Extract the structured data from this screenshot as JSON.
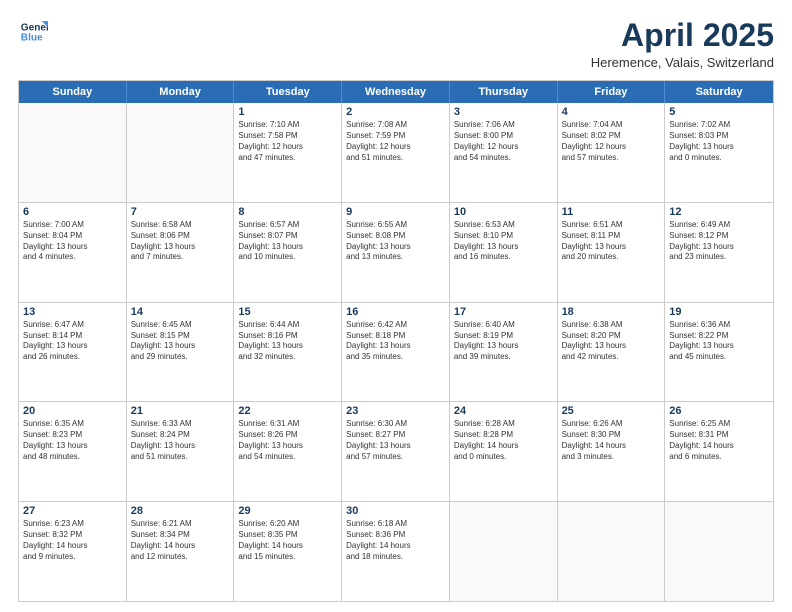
{
  "header": {
    "logo_line1": "General",
    "logo_line2": "Blue",
    "month": "April 2025",
    "location": "Heremence, Valais, Switzerland"
  },
  "days_of_week": [
    "Sunday",
    "Monday",
    "Tuesday",
    "Wednesday",
    "Thursday",
    "Friday",
    "Saturday"
  ],
  "weeks": [
    [
      {
        "day": "",
        "empty": true
      },
      {
        "day": "",
        "empty": true
      },
      {
        "day": "1",
        "lines": [
          "Sunrise: 7:10 AM",
          "Sunset: 7:58 PM",
          "Daylight: 12 hours",
          "and 47 minutes."
        ]
      },
      {
        "day": "2",
        "lines": [
          "Sunrise: 7:08 AM",
          "Sunset: 7:59 PM",
          "Daylight: 12 hours",
          "and 51 minutes."
        ]
      },
      {
        "day": "3",
        "lines": [
          "Sunrise: 7:06 AM",
          "Sunset: 8:00 PM",
          "Daylight: 12 hours",
          "and 54 minutes."
        ]
      },
      {
        "day": "4",
        "lines": [
          "Sunrise: 7:04 AM",
          "Sunset: 8:02 PM",
          "Daylight: 12 hours",
          "and 57 minutes."
        ]
      },
      {
        "day": "5",
        "lines": [
          "Sunrise: 7:02 AM",
          "Sunset: 8:03 PM",
          "Daylight: 13 hours",
          "and 0 minutes."
        ]
      }
    ],
    [
      {
        "day": "6",
        "lines": [
          "Sunrise: 7:00 AM",
          "Sunset: 8:04 PM",
          "Daylight: 13 hours",
          "and 4 minutes."
        ]
      },
      {
        "day": "7",
        "lines": [
          "Sunrise: 6:58 AM",
          "Sunset: 8:06 PM",
          "Daylight: 13 hours",
          "and 7 minutes."
        ]
      },
      {
        "day": "8",
        "lines": [
          "Sunrise: 6:57 AM",
          "Sunset: 8:07 PM",
          "Daylight: 13 hours",
          "and 10 minutes."
        ]
      },
      {
        "day": "9",
        "lines": [
          "Sunrise: 6:55 AM",
          "Sunset: 8:08 PM",
          "Daylight: 13 hours",
          "and 13 minutes."
        ]
      },
      {
        "day": "10",
        "lines": [
          "Sunrise: 6:53 AM",
          "Sunset: 8:10 PM",
          "Daylight: 13 hours",
          "and 16 minutes."
        ]
      },
      {
        "day": "11",
        "lines": [
          "Sunrise: 6:51 AM",
          "Sunset: 8:11 PM",
          "Daylight: 13 hours",
          "and 20 minutes."
        ]
      },
      {
        "day": "12",
        "lines": [
          "Sunrise: 6:49 AM",
          "Sunset: 8:12 PM",
          "Daylight: 13 hours",
          "and 23 minutes."
        ]
      }
    ],
    [
      {
        "day": "13",
        "lines": [
          "Sunrise: 6:47 AM",
          "Sunset: 8:14 PM",
          "Daylight: 13 hours",
          "and 26 minutes."
        ]
      },
      {
        "day": "14",
        "lines": [
          "Sunrise: 6:45 AM",
          "Sunset: 8:15 PM",
          "Daylight: 13 hours",
          "and 29 minutes."
        ]
      },
      {
        "day": "15",
        "lines": [
          "Sunrise: 6:44 AM",
          "Sunset: 8:16 PM",
          "Daylight: 13 hours",
          "and 32 minutes."
        ]
      },
      {
        "day": "16",
        "lines": [
          "Sunrise: 6:42 AM",
          "Sunset: 8:18 PM",
          "Daylight: 13 hours",
          "and 35 minutes."
        ]
      },
      {
        "day": "17",
        "lines": [
          "Sunrise: 6:40 AM",
          "Sunset: 8:19 PM",
          "Daylight: 13 hours",
          "and 39 minutes."
        ]
      },
      {
        "day": "18",
        "lines": [
          "Sunrise: 6:38 AM",
          "Sunset: 8:20 PM",
          "Daylight: 13 hours",
          "and 42 minutes."
        ]
      },
      {
        "day": "19",
        "lines": [
          "Sunrise: 6:36 AM",
          "Sunset: 8:22 PM",
          "Daylight: 13 hours",
          "and 45 minutes."
        ]
      }
    ],
    [
      {
        "day": "20",
        "lines": [
          "Sunrise: 6:35 AM",
          "Sunset: 8:23 PM",
          "Daylight: 13 hours",
          "and 48 minutes."
        ]
      },
      {
        "day": "21",
        "lines": [
          "Sunrise: 6:33 AM",
          "Sunset: 8:24 PM",
          "Daylight: 13 hours",
          "and 51 minutes."
        ]
      },
      {
        "day": "22",
        "lines": [
          "Sunrise: 6:31 AM",
          "Sunset: 8:26 PM",
          "Daylight: 13 hours",
          "and 54 minutes."
        ]
      },
      {
        "day": "23",
        "lines": [
          "Sunrise: 6:30 AM",
          "Sunset: 8:27 PM",
          "Daylight: 13 hours",
          "and 57 minutes."
        ]
      },
      {
        "day": "24",
        "lines": [
          "Sunrise: 6:28 AM",
          "Sunset: 8:28 PM",
          "Daylight: 14 hours",
          "and 0 minutes."
        ]
      },
      {
        "day": "25",
        "lines": [
          "Sunrise: 6:26 AM",
          "Sunset: 8:30 PM",
          "Daylight: 14 hours",
          "and 3 minutes."
        ]
      },
      {
        "day": "26",
        "lines": [
          "Sunrise: 6:25 AM",
          "Sunset: 8:31 PM",
          "Daylight: 14 hours",
          "and 6 minutes."
        ]
      }
    ],
    [
      {
        "day": "27",
        "lines": [
          "Sunrise: 6:23 AM",
          "Sunset: 8:32 PM",
          "Daylight: 14 hours",
          "and 9 minutes."
        ]
      },
      {
        "day": "28",
        "lines": [
          "Sunrise: 6:21 AM",
          "Sunset: 8:34 PM",
          "Daylight: 14 hours",
          "and 12 minutes."
        ]
      },
      {
        "day": "29",
        "lines": [
          "Sunrise: 6:20 AM",
          "Sunset: 8:35 PM",
          "Daylight: 14 hours",
          "and 15 minutes."
        ]
      },
      {
        "day": "30",
        "lines": [
          "Sunrise: 6:18 AM",
          "Sunset: 8:36 PM",
          "Daylight: 14 hours",
          "and 18 minutes."
        ]
      },
      {
        "day": "",
        "empty": true
      },
      {
        "day": "",
        "empty": true
      },
      {
        "day": "",
        "empty": true
      }
    ]
  ]
}
